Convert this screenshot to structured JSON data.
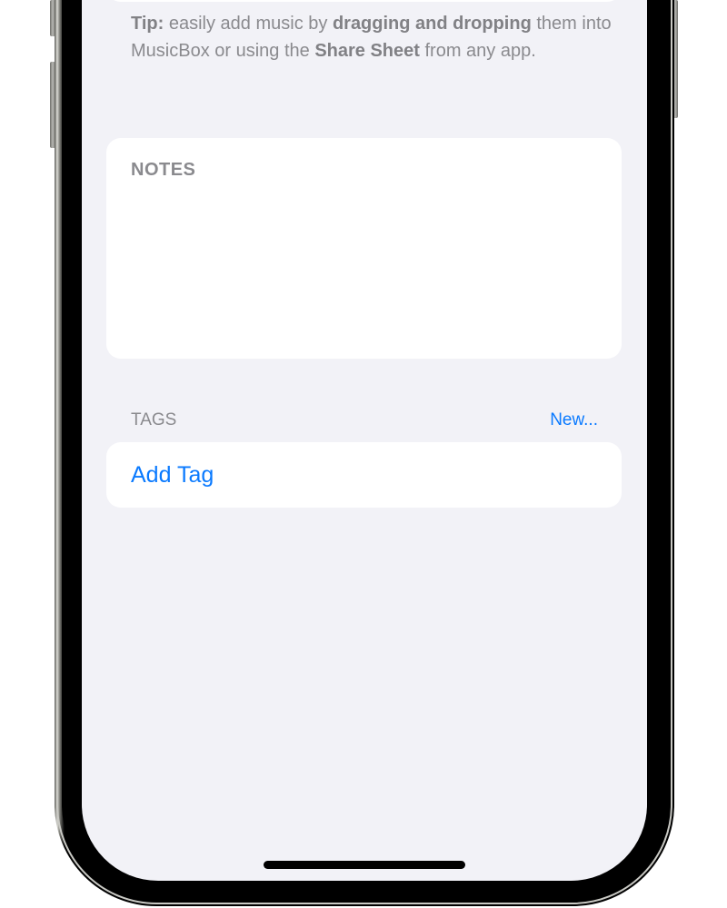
{
  "tip": {
    "label": "Tip:",
    "text1": " easily add music by ",
    "bold1": "dragging and dropping",
    "text2": " them into MusicBox or using the ",
    "bold2": "Share Sheet",
    "text3": " from any app."
  },
  "notes": {
    "label": "NOTES"
  },
  "tags": {
    "label": "TAGS",
    "new_button": "New...",
    "add_tag": "Add Tag"
  },
  "colors": {
    "accent": "#0a7aff",
    "background": "#f2f2f7",
    "secondary_text": "#8a8a8e"
  }
}
